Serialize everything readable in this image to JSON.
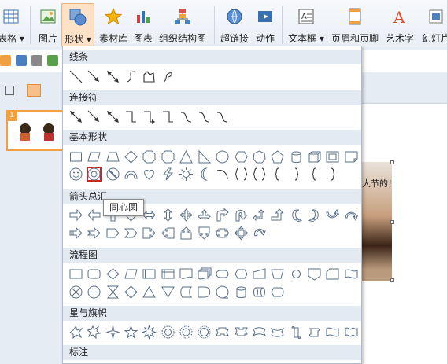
{
  "ribbon": {
    "buttons": [
      {
        "id": "table",
        "label": "表格 ▾",
        "icon": "table-icon"
      },
      {
        "id": "picture",
        "label": "图片",
        "icon": "picture-icon"
      },
      {
        "id": "shapes",
        "label": "形状 ▾",
        "icon": "shapes-icon",
        "active": true
      },
      {
        "id": "material",
        "label": "素材库",
        "icon": "star-icon"
      },
      {
        "id": "chart",
        "label": "图表",
        "icon": "chart-icon"
      },
      {
        "id": "org",
        "label": "组织结构图",
        "icon": "org-chart-icon"
      },
      {
        "id": "hyperlink",
        "label": "超链接",
        "icon": "hyperlink-icon"
      },
      {
        "id": "animation",
        "label": "动作",
        "icon": "action-icon"
      },
      {
        "id": "textbox",
        "label": "文本框 ▾",
        "icon": "textbox-icon"
      },
      {
        "id": "header",
        "label": "页眉和页脚",
        "icon": "header-footer-icon"
      },
      {
        "id": "art",
        "label": "艺术字",
        "icon": "wordart-icon"
      },
      {
        "id": "slide",
        "label": "幻灯片",
        "icon": "slide-icon"
      }
    ]
  },
  "panel": {
    "sections": [
      {
        "title": "线条"
      },
      {
        "title": "连接符"
      },
      {
        "title": "基本形状"
      },
      {
        "title": "箭头总汇"
      },
      {
        "title": "流程图"
      },
      {
        "title": "星与旗帜"
      },
      {
        "title": "标注"
      }
    ],
    "tooltip": "同心圆"
  },
  "slide_panel": {
    "slide_number": "1"
  },
  "canvas": {
    "picture_text": "大节的！"
  },
  "colors": {
    "accent": "#f0a040",
    "selection": "#d42020",
    "header_bg": "#e4eaf2"
  }
}
